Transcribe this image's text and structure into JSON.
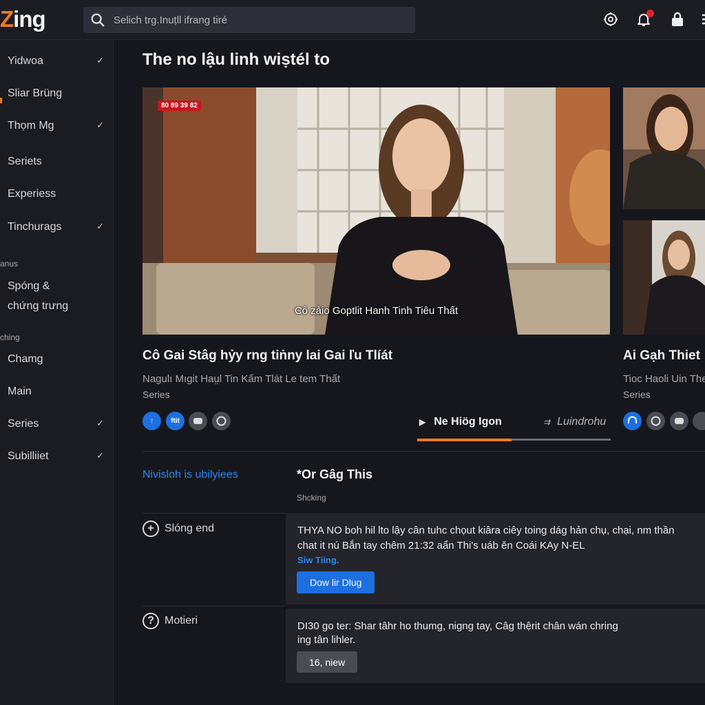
{
  "header": {
    "logo_accent": "Z",
    "logo_rest": "ing",
    "search_placeholder": "Selich trg.Inuṭll ifrang tiré",
    "icons": [
      "search-icon",
      "settings-icon",
      "bell-icon",
      "lock-icon",
      "menu-icon"
    ],
    "notification_badge_color": "#e0242e"
  },
  "sidebar": {
    "items": [
      {
        "label": "Yidwoa",
        "check": "✓"
      },
      {
        "label": "Sliar Brüng",
        "check": ""
      },
      {
        "label": "Thọm Mg",
        "check": "✓"
      },
      {
        "label": "Seriets",
        "check": ""
      },
      {
        "label": "Experiess",
        "check": ""
      },
      {
        "label": "Tinchurags",
        "check": "✓"
      }
    ],
    "head1": "anus",
    "group2": [
      {
        "label": "Spóng &",
        "check": ""
      },
      {
        "label": "chứng trưng",
        "check": ""
      }
    ],
    "head2": "ching",
    "group3": [
      {
        "label": "Chamg",
        "check": ""
      },
      {
        "label": "Main",
        "check": ""
      },
      {
        "label": "Series",
        "check": "✓"
      },
      {
        "label": "Subilliiet",
        "check": "✓"
      }
    ]
  },
  "main": {
    "page_title": "The no lậu linh wiṣtél to",
    "video": {
      "badge": "80 89 39 82",
      "subtitle": "Cô zảio Goptlit Hanh Tinh Tiêu Thất",
      "title": "Cô Gai Stâg hỷy rng tiṅny lai Gai ľu Tlíát",
      "sub": "Nagulı Mıgit Haṳl Tin Kấm Tlát Le tem Thất",
      "type": "Series",
      "buttons": [
        "↑",
        "ftit",
        "",
        ""
      ]
    },
    "side_video": {
      "title": "Ai Gạh Thiet",
      "sub": "Tioc Haoli Uin The",
      "type": "Series"
    },
    "tabs": [
      {
        "label": "Ne Hiög Igon",
        "icon": "play-icon",
        "active": true
      },
      {
        "label": "Luindrohu",
        "icon": "forward-icon",
        "active": false
      }
    ],
    "accent_color": "#f07a1e",
    "blue_color": "#1d6fe0"
  },
  "detail": {
    "link": "Nivisloh is ubilyiees",
    "title": "*Or Gâg This",
    "sub": "Shcking",
    "rows": [
      {
        "label": "Slóng end",
        "icon": "plus-circle-icon",
        "line1": "THYA NO boh hil lto lậy cân tuhc chọut kiâra ciêy toing dág hản chụ, chại, nm thần",
        "line2": "chat it nú Bắn tay chêm 21:32 aẩn Thi's uáb ěn Coái KAy N-EL",
        "link": "Siw Tiing.",
        "button": "Dow lir Dlug"
      },
      {
        "label": "Motieri",
        "icon": "help-circle-icon",
        "line1": "DI30 go ter: Shar tâhr ho thumg, nigng tay, Câg thệrit chân wán chring",
        "line2": "ing tân lihler.",
        "button": "16, niew"
      }
    ]
  }
}
